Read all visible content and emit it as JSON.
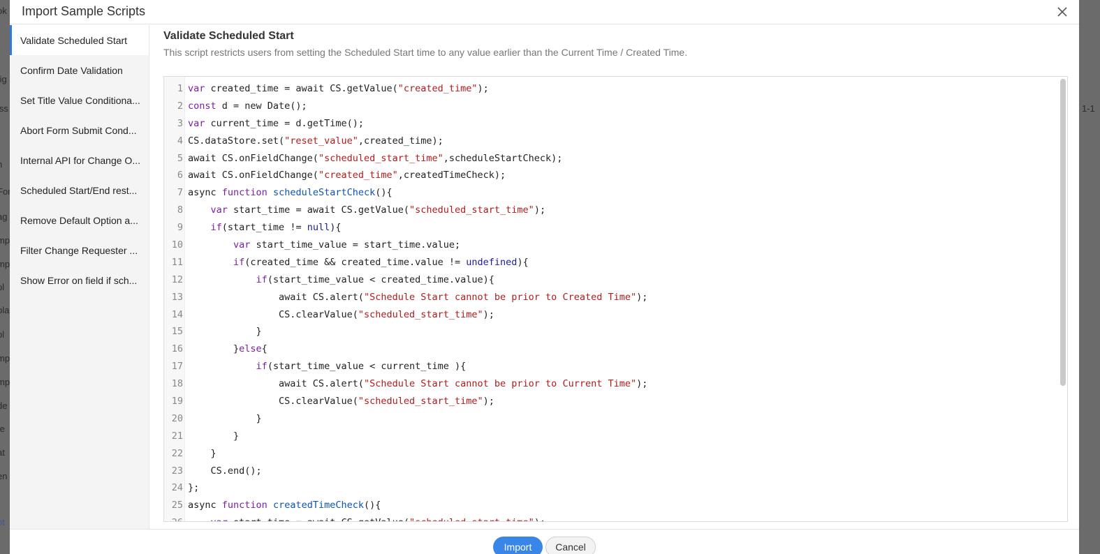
{
  "modal": {
    "title": "Import Sample Scripts",
    "close_icon": "close-icon"
  },
  "sidebar": {
    "items": [
      {
        "label": "Validate Scheduled Start",
        "active": true
      },
      {
        "label": "Confirm Date Validation",
        "active": false
      },
      {
        "label": "Set Title Value Conditiona...",
        "active": false
      },
      {
        "label": "Abort Form Submit Cond...",
        "active": false
      },
      {
        "label": "Internal API for Change O...",
        "active": false
      },
      {
        "label": "Scheduled Start/End rest...",
        "active": false
      },
      {
        "label": "Remove Default Option a...",
        "active": false
      },
      {
        "label": "Filter Change Requester ...",
        "active": false
      },
      {
        "label": "Show Error on field if sch...",
        "active": false
      }
    ]
  },
  "script": {
    "title": "Validate Scheduled Start",
    "description": "This script restricts users from setting the Scheduled Start time to any value earlier than the Current Time / Created Time."
  },
  "code": {
    "lines": [
      "var created_time = await CS.getValue(\"created_time\");",
      "const d = new Date();",
      "var current_time = d.getTime();",
      "CS.dataStore.set(\"reset_value\",created_time);",
      "await CS.onFieldChange(\"scheduled_start_time\",scheduleStartCheck);",
      "await CS.onFieldChange(\"created_time\",createdTimeCheck);",
      "async function scheduleStartCheck(){",
      "    var start_time = await CS.getValue(\"scheduled_start_time\");",
      "    if(start_time != null){",
      "        var start_time_value = start_time.value;",
      "        if(created_time && created_time.value != undefined){",
      "            if(start_time_value < created_time.value){",
      "                await CS.alert(\"Schedule Start cannot be prior to Created Time\");",
      "                CS.clearValue(\"scheduled_start_time\");",
      "            }",
      "        }else{",
      "            if(start_time_value < current_time ){",
      "                await CS.alert(\"Schedule Start cannot be prior to Current Time\");",
      "                CS.clearValue(\"scheduled_start_time\");",
      "            }",
      "        }",
      "    }",
      "    CS.end();",
      "};",
      "async function createdTimeCheck(){",
      "    var start_time = await CS.getValue(\"scheduled_start_time\");"
    ]
  },
  "footer": {
    "import_label": "Import",
    "cancel_label": "Cancel"
  },
  "colors": {
    "accent": "#3a86e8",
    "keyword": "#7a1fa2",
    "string": "#b31b1b",
    "function_name": "#0b55b5"
  }
}
